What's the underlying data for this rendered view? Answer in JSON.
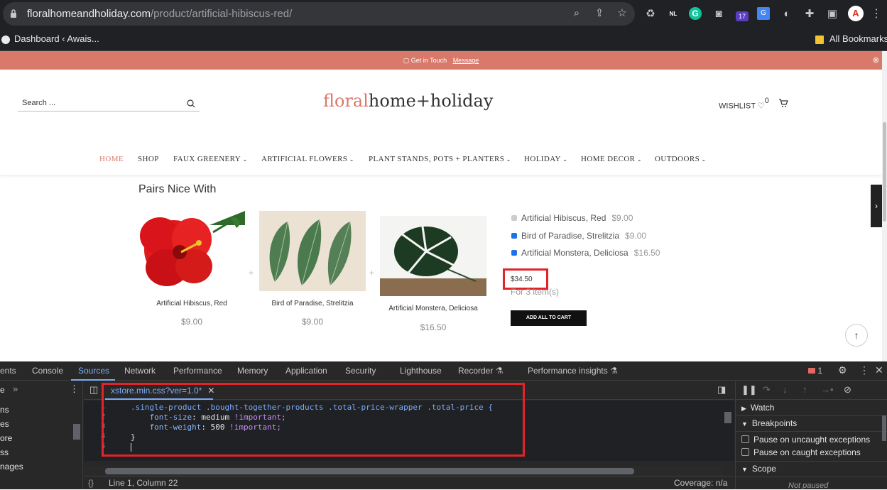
{
  "browser": {
    "url_domain": "floralhomeandholiday.com",
    "url_path": "/product/artificial-hibiscus-red/",
    "bookmark_left": "Dashboard ‹ Awais...",
    "bookmark_right": "All Bookmarks",
    "ext_badge_nl": "NL",
    "ext_badge_count": "17"
  },
  "site": {
    "promo_text": "Get in Touch",
    "promo_link": "Message",
    "search_placeholder": "Search ...",
    "logo_a": "floral",
    "logo_b": "home+holiday",
    "wishlist_label": "WISHLIST",
    "wishlist_count": "0",
    "nav": [
      {
        "label": "HOME"
      },
      {
        "label": "SHOP"
      },
      {
        "label": "FAUX GREENERY"
      },
      {
        "label": "ARTIFICIAL FLOWERS"
      },
      {
        "label": "PLANT STANDS, POTS + PLANTERS"
      },
      {
        "label": "HOLIDAY"
      },
      {
        "label": "HOME DECOR"
      },
      {
        "label": "OUTDOORS"
      }
    ]
  },
  "pairs": {
    "title": "Pairs Nice With",
    "products": [
      {
        "name": "Artificial Hibiscus, Red",
        "price": "$9.00"
      },
      {
        "name": "Bird of Paradise, Strelitzia",
        "price": "$9.00"
      },
      {
        "name": "Artificial Monstera, Deliciosa",
        "price": "$16.50"
      }
    ],
    "checklist": [
      {
        "name": "Artificial Hibiscus, Red",
        "price": "$9.00"
      },
      {
        "name": "Bird of Paradise, Strelitzia",
        "price": "$9.00"
      },
      {
        "name": "Artificial Monstera, Deliciosa",
        "price": "$16.50"
      }
    ],
    "total": "$34.50",
    "items_text": "For 3 item(s)",
    "add_all": "ADD ALL TO CART"
  },
  "devtools": {
    "tabs": [
      "ents",
      "Console",
      "Sources",
      "Network",
      "Performance",
      "Memory",
      "Application",
      "Security",
      "Lighthouse",
      "Recorder",
      "Performance insights"
    ],
    "issues_count": "1",
    "nav_pane_files": [
      "ns",
      "es",
      "ore",
      "ss",
      "nages"
    ],
    "nav_pane_label": "e",
    "file_tab": "xstore.min.css?ver=1.0*",
    "code_lines": [
      {
        "n": "1",
        "selector": ".single-product .bought-together-products .total-price-wrapper .total-price {"
      },
      {
        "n": "2",
        "prop": "font-size",
        "value": "medium",
        "important": "!important;"
      },
      {
        "n": "3",
        "prop": "font-weight",
        "value": "500",
        "important": "!important;"
      },
      {
        "n": "4",
        "text": "}"
      },
      {
        "n": "5",
        "text": ""
      }
    ],
    "status_position": "Line 1, Column 22",
    "status_coverage": "Coverage: n/a",
    "debug": {
      "watch": "Watch",
      "breakpoints": "Breakpoints",
      "pause_uncaught": "Pause on uncaught exceptions",
      "pause_caught": "Pause on caught exceptions",
      "scope": "Scope",
      "not_paused": "Not paused"
    }
  }
}
